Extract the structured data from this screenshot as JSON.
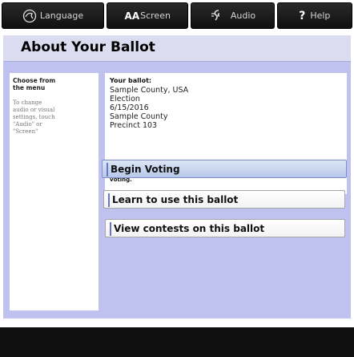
{
  "toolbar": {
    "language_label": "Language",
    "screen_aa": "AA",
    "screen_label": "Screen",
    "audio_label": "Audio",
    "help_label": "Help"
  },
  "page": {
    "title": "About Your Ballot"
  },
  "sidebar": {
    "heading_line1": "Choose from",
    "heading_line2": "the menu",
    "body_lines": [
      "To change",
      "audio or visual",
      "settings, touch",
      "\"Audio\" or",
      "\"Screen\""
    ]
  },
  "ballot_info": {
    "heading": "Your ballot:",
    "lines": [
      "Sample County, USA",
      "Election",
      "6/15/2016",
      "Sample County",
      "Precinct 103"
    ],
    "warning": "If any of the above information is wrong, contact a poll worker before voting."
  },
  "actions": {
    "begin_voting": "Begin Voting",
    "learn": "Learn to use this ballot",
    "view_contests": "View contests on this ballot"
  },
  "colors": {
    "toolbar_bg": "#151515",
    "panel_bg": "#bfc2ee",
    "title_bar_bg": "#dcdcf0",
    "primary_accent": "#6a75c9"
  }
}
